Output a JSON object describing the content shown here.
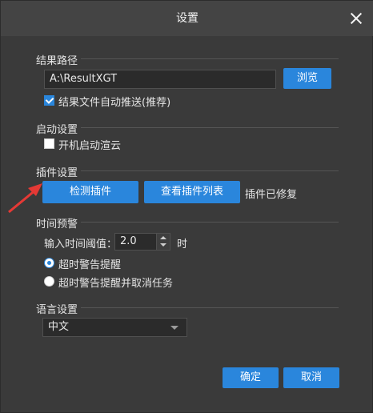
{
  "dialog": {
    "title": "设置"
  },
  "result_path": {
    "section_label": "结果路径",
    "path_value": "A:\\ResultXGT",
    "browse_label": "浏览",
    "auto_push_label": "结果文件自动推送(推荐)",
    "auto_push_checked": true
  },
  "startup": {
    "section_label": "启动设置",
    "autostart_label": "开机启动渲云",
    "autostart_checked": false
  },
  "plugin": {
    "section_label": "插件设置",
    "detect_label": "检测插件",
    "list_label": "查看插件列表",
    "status_text": "插件已修复"
  },
  "time_warning": {
    "section_label": "时间预警",
    "threshold_label": "输入时间阈值：",
    "threshold_value": "2.0",
    "unit": "时",
    "option_warn": "超时警告提醒",
    "option_warn_cancel": "超时警告提醒并取消任务",
    "selected": "warn"
  },
  "language": {
    "section_label": "语言设置",
    "selected": "中文"
  },
  "footer": {
    "ok_label": "确定",
    "cancel_label": "取消"
  },
  "colors": {
    "accent": "#2a86dc",
    "annotation_arrow": "#e53935",
    "background": "#3a3a3a"
  }
}
